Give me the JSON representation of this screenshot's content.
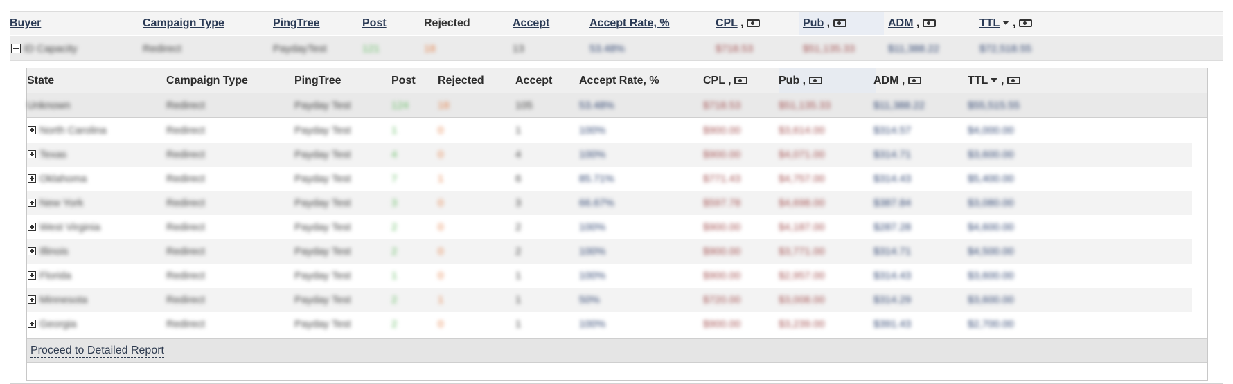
{
  "outer_table": {
    "headers": {
      "buyer": "Buyer",
      "campaign_type": "Campaign Type",
      "pingtree": "PingTree",
      "post": "Post",
      "rejected": "Rejected",
      "accept": "Accept",
      "accept_rate": "Accept Rate, %",
      "cpl": "CPL",
      "pub": "Pub",
      "adm": "ADM",
      "ttl": "TTL"
    },
    "separator": ",",
    "row": {
      "buyer": "ID Capacity",
      "campaign_type": "Redirect",
      "pingtree": "PaydayTest",
      "post": "121",
      "rejected": "18",
      "accept": "13",
      "accept_rate": "53.48%",
      "cpl": "$718.53",
      "pub": "$51,135.33",
      "adm": "$11,388.22",
      "ttl": "$72,518.55"
    }
  },
  "inner_table": {
    "headers": {
      "state": "State",
      "campaign_type": "Campaign Type",
      "pingtree": "PingTree",
      "post": "Post",
      "rejected": "Rejected",
      "accept": "Accept",
      "accept_rate": "Accept Rate, %",
      "cpl": "CPL",
      "pub": "Pub",
      "adm": "ADM",
      "ttl": "TTL"
    },
    "total_row": {
      "state": "Unknown",
      "campaign_type": "Redirect",
      "pingtree": "Payday Test",
      "post": "124",
      "rejected": "18",
      "accept": "105",
      "accept_rate": "53.48%",
      "cpl": "$718.53",
      "pub": "$51,135.33",
      "adm": "$11,388.22",
      "ttl": "$55,515.55"
    },
    "rows": [
      {
        "state": "North Carolina",
        "campaign_type": "Redirect",
        "pingtree": "Payday Test",
        "post": "1",
        "rejected": "0",
        "accept": "1",
        "accept_rate": "100%",
        "cpl": "$900.00",
        "pub": "$3,614.00",
        "adm": "$314.57",
        "ttl": "$4,000.00"
      },
      {
        "state": "Texas",
        "campaign_type": "Redirect",
        "pingtree": "Payday Test",
        "post": "4",
        "rejected": "0",
        "accept": "4",
        "accept_rate": "100%",
        "cpl": "$900.00",
        "pub": "$4,071.00",
        "adm": "$314.71",
        "ttl": "$3,600.00"
      },
      {
        "state": "Oklahoma",
        "campaign_type": "Redirect",
        "pingtree": "Payday Test",
        "post": "7",
        "rejected": "1",
        "accept": "6",
        "accept_rate": "85.71%",
        "cpl": "$771.43",
        "pub": "$4,757.00",
        "adm": "$314.43",
        "ttl": "$5,400.00"
      },
      {
        "state": "New York",
        "campaign_type": "Redirect",
        "pingtree": "Payday Test",
        "post": "3",
        "rejected": "0",
        "accept": "3",
        "accept_rate": "66.67%",
        "cpl": "$597.78",
        "pub": "$4,698.00",
        "adm": "$387.84",
        "ttl": "$3,080.00"
      },
      {
        "state": "West Virginia",
        "campaign_type": "Redirect",
        "pingtree": "Payday Test",
        "post": "2",
        "rejected": "0",
        "accept": "2",
        "accept_rate": "100%",
        "cpl": "$900.00",
        "pub": "$4,187.00",
        "adm": "$287.28",
        "ttl": "$4,600.00"
      },
      {
        "state": "Illinois",
        "campaign_type": "Redirect",
        "pingtree": "Payday Test",
        "post": "2",
        "rejected": "0",
        "accept": "2",
        "accept_rate": "100%",
        "cpl": "$900.00",
        "pub": "$3,771.00",
        "adm": "$314.71",
        "ttl": "$4,500.00"
      },
      {
        "state": "Florida",
        "campaign_type": "Redirect",
        "pingtree": "Payday Test",
        "post": "1",
        "rejected": "0",
        "accept": "1",
        "accept_rate": "100%",
        "cpl": "$900.00",
        "pub": "$2,957.00",
        "adm": "$314.43",
        "ttl": "$3,600.00"
      },
      {
        "state": "Minnesota",
        "campaign_type": "Redirect",
        "pingtree": "Payday Test",
        "post": "2",
        "rejected": "1",
        "accept": "1",
        "accept_rate": "50%",
        "cpl": "$720.00",
        "pub": "$3,008.00",
        "adm": "$314.29",
        "ttl": "$3,600.00"
      },
      {
        "state": "Georgia",
        "campaign_type": "Redirect",
        "pingtree": "Payday Test",
        "post": "2",
        "rejected": "0",
        "accept": "1",
        "accept_rate": "100%",
        "cpl": "$900.00",
        "pub": "$3,239.00",
        "adm": "$391.43",
        "ttl": "$2,700.00"
      }
    ],
    "footer_link": "Proceed to Detailed Report"
  },
  "icons": {
    "money": "money-icon",
    "sort": "sort-desc-icon",
    "collapse": "collapse-icon",
    "expand": "expand-icon"
  },
  "colors": {
    "post": "#6abf69",
    "rejected": "#e5844d",
    "cpl_pub": "#a35252",
    "adm_ttl": "#2f4470"
  }
}
